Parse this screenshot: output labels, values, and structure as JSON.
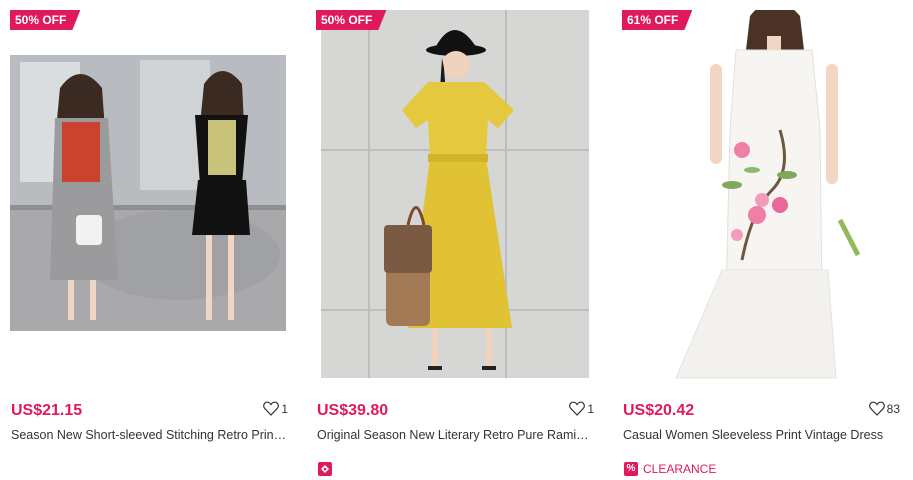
{
  "products": [
    {
      "badge": "50% OFF",
      "price": "US$21.15",
      "likes": "1",
      "title": "Season New Short-sleeved Stitching Retro Print ...",
      "image": "two-women-dress-photo"
    },
    {
      "badge": "50% OFF",
      "price": "US$39.80",
      "likes": "1",
      "title": "Original Season New Literary Retro Pure Ramie ...",
      "image": "yellow-dress-photo",
      "tag_icon": "promo-icon"
    },
    {
      "badge": "61% OFF",
      "price": "US$20.42",
      "likes": "83",
      "title": "Casual Women Sleeveless Print Vintage Dress",
      "image": "white-floral-dress-photo",
      "tag_icon": "percent-icon",
      "tag": "CLEARANCE"
    }
  ],
  "colors": {
    "accent": "#e0195f"
  }
}
